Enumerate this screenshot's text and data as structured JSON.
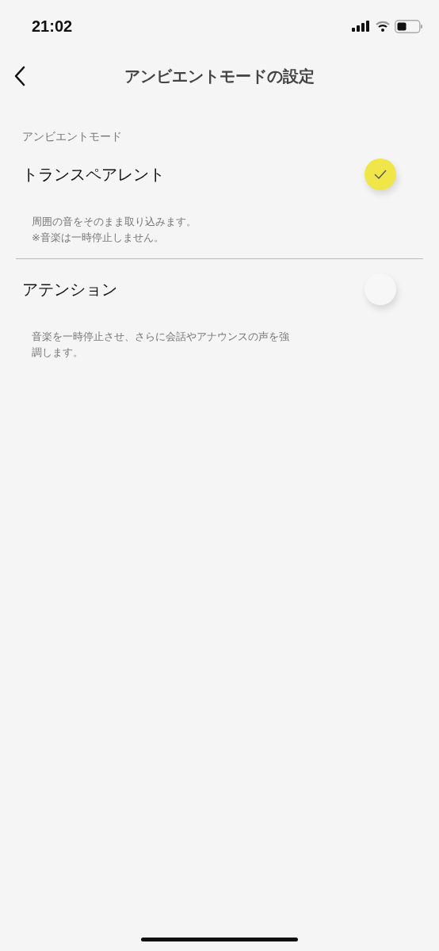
{
  "status_bar": {
    "time": "21:02"
  },
  "nav": {
    "title": "アンビエントモードの設定"
  },
  "section": {
    "header": "アンビエントモード"
  },
  "options": [
    {
      "label": "トランスペアレント",
      "selected": true,
      "description": [
        "周囲の音をそのまま取り込みます。",
        "※音楽は一時停止しません。"
      ]
    },
    {
      "label": "アテンション",
      "selected": false,
      "description": [
        "音楽を一時停止させ、さらに会話やアナウンスの声を強",
        "調します。"
      ]
    }
  ]
}
